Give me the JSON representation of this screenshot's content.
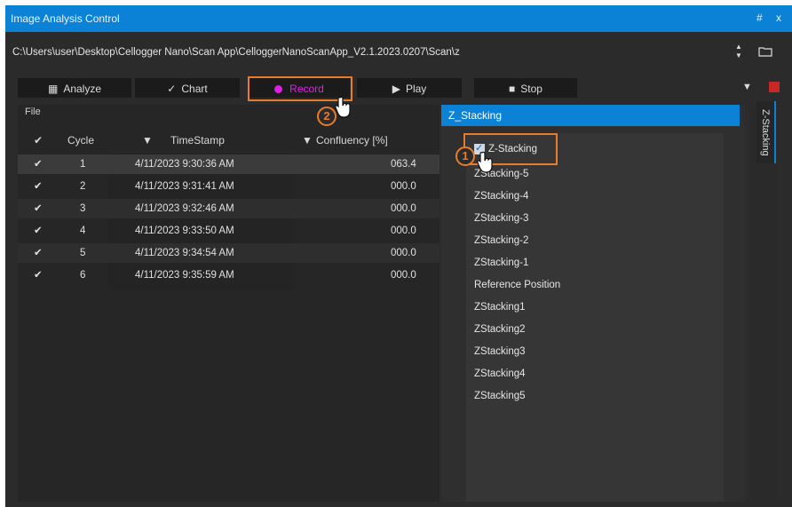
{
  "window": {
    "title": "Image Analysis Control",
    "controls": "# x"
  },
  "path": "C:\\Users\\user\\Desktop\\Cellogger Nano\\Scan App\\CelloggerNanoScanApp_V2.1.2023.0207\\Scan\\z",
  "toolbar": {
    "analyze": "Analyze",
    "chart": "Chart",
    "record": "Record",
    "play": "Play",
    "stop": "Stop"
  },
  "left_panel": {
    "file_label": "File",
    "columns": {
      "check": "✔",
      "cycle": "Cycle",
      "timestamp": "TimeStamp",
      "confluency": "Confluency [%]"
    },
    "rows": [
      {
        "check": "✔",
        "cycle": "1",
        "timestamp": "4/11/2023 9:30:36 AM",
        "confluency": "063.4"
      },
      {
        "check": "✔",
        "cycle": "2",
        "timestamp": "4/11/2023 9:31:41 AM",
        "confluency": "000.0"
      },
      {
        "check": "✔",
        "cycle": "3",
        "timestamp": "4/11/2023 9:32:46 AM",
        "confluency": "000.0"
      },
      {
        "check": "✔",
        "cycle": "4",
        "timestamp": "4/11/2023 9:33:50 AM",
        "confluency": "000.0"
      },
      {
        "check": "✔",
        "cycle": "5",
        "timestamp": "4/11/2023 9:34:54 AM",
        "confluency": "000.0"
      },
      {
        "check": "✔",
        "cycle": "6",
        "timestamp": "4/11/2023 9:35:59 AM",
        "confluency": "000.0"
      }
    ]
  },
  "right_panel": {
    "header": "Z_Stacking",
    "checkbox_label": "Z-Stacking",
    "items": [
      "ZStacking-5",
      "ZStacking-4",
      "ZStacking-3",
      "ZStacking-2",
      "ZStacking-1",
      "Reference Position",
      "ZStacking1",
      "ZStacking2",
      "ZStacking3",
      "ZStacking4",
      "ZStacking5"
    ]
  },
  "side_tab": "Z-Stacking",
  "badges": {
    "one": "1",
    "two": "2"
  },
  "colors": {
    "accent": "#0b82d6",
    "highlight": "#e87c2a",
    "record": "#e31ee3"
  }
}
